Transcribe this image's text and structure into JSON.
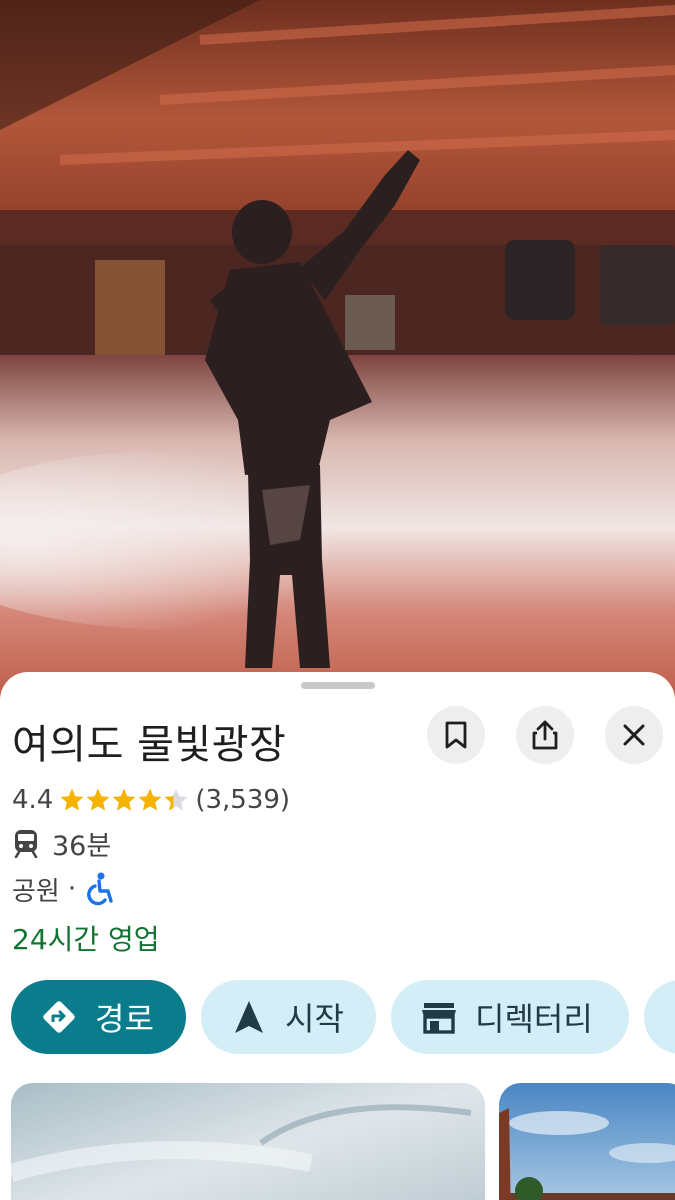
{
  "place": {
    "name": "여의도 물빛광장",
    "rating": "4.4",
    "stars_value": 4.4,
    "stars_max": 5,
    "review_count": "(3,539)",
    "transit_time": "36분",
    "category": "공원",
    "separator": "·",
    "hours_status": "24시간 영업"
  },
  "header_actions": {
    "save_icon": "bookmark-icon",
    "share_icon": "share-icon",
    "close_icon": "close-icon"
  },
  "actions": {
    "directions": "경로",
    "start": "시작",
    "directory": "디렉터리"
  },
  "colors": {
    "accent": "#0b7c8c",
    "chip_bg": "#d3eef6",
    "open_green": "#137333",
    "star": "#f6b400",
    "accessible_blue": "#1a73e8"
  }
}
